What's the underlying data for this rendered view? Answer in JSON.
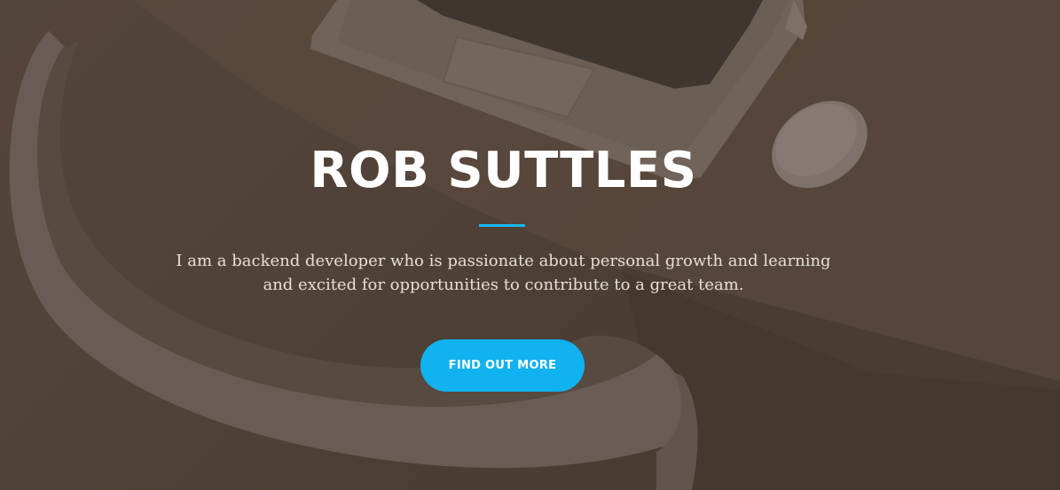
{
  "hero": {
    "title": "ROB SUTTLES",
    "tagline": "I am a backend developer who is passionate about personal growth and learning and excited for opportunities to contribute to a great team.",
    "cta_label": "FIND OUT MORE",
    "accent_color": "#10b3f0",
    "background_image": "laptop-mouse-chair-on-desk-photo"
  }
}
